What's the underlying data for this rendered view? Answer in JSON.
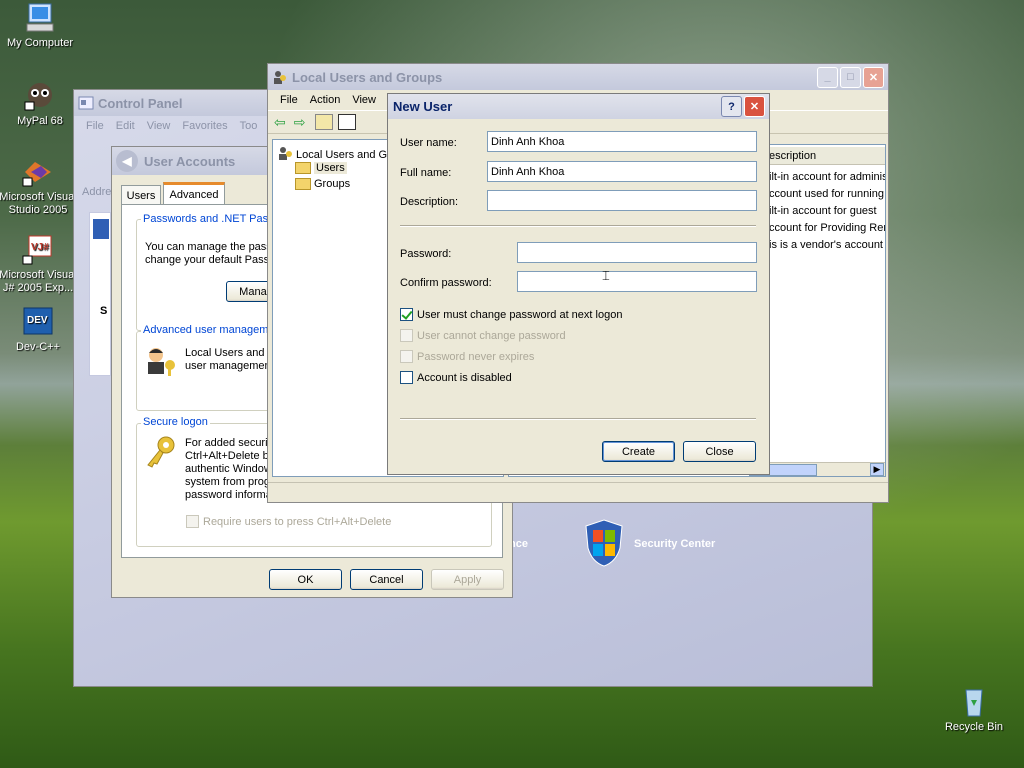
{
  "desktop": {
    "icons": [
      {
        "name": "my-computer",
        "label": "My Computer"
      },
      {
        "name": "mypal",
        "label": "MyPal 68"
      },
      {
        "name": "visual-studio",
        "label": "Microsoft Visual Studio 2005"
      },
      {
        "name": "visual-jsharp",
        "label": "Microsoft Visual J# 2005 Exp..."
      },
      {
        "name": "dev-cpp",
        "label": "Dev-C++"
      },
      {
        "name": "recycle-bin",
        "label": "Recycle Bin"
      }
    ]
  },
  "control_panel": {
    "title": "Control Panel",
    "menu": [
      "File",
      "Edit",
      "View",
      "Favorites",
      "Too"
    ],
    "address_label": "Addre",
    "security_center_label": "Security Center",
    "partial_label": "nce"
  },
  "user_accounts": {
    "title": "User Accounts",
    "tabs": [
      "Users",
      "Advanced"
    ],
    "active_tab": "Advanced",
    "passwords_group": "Passwords and .NET Passp",
    "passwords_text_1": "You can manage the pass",
    "passwords_text_2": "change your default Passp",
    "manage_button": "Manag",
    "advanced_group": "Advanced user manageme",
    "advanced_text_1": "Local Users and G",
    "advanced_text_2": "user managemen",
    "secure_group": "Secure logon",
    "secure_lines": [
      "For added securi",
      "Ctrl+Alt+Delete b",
      "authentic Window",
      "system from prog",
      "password informa"
    ],
    "require_ctrl_alt_del": "Require users to press Ctrl+Alt+Delete",
    "left_header": "S",
    "buttons": {
      "ok": "OK",
      "cancel": "Cancel",
      "apply": "Apply"
    }
  },
  "lusrmgr": {
    "title": "Local Users and Groups",
    "menu": [
      "File",
      "Action",
      "View"
    ],
    "tree_root": "Local Users and Gr",
    "tree_items": [
      "Users",
      "Groups"
    ],
    "column_header": "escription",
    "descriptions": [
      "ilt-in account for adminis",
      "ccount used for running",
      "ilt-in account for guest",
      "ccount for Providing Rem",
      "is is a vendor's account"
    ]
  },
  "new_user": {
    "title": "New User",
    "help": "?",
    "labels": {
      "username": "User name:",
      "fullname": "Full name:",
      "description": "Description:",
      "password": "Password:",
      "confirm": "Confirm password:"
    },
    "values": {
      "username": "Dinh Anh Khoa",
      "fullname": "Dinh Anh Khoa",
      "description": "",
      "password": "",
      "confirm": ""
    },
    "options": {
      "must_change": "User must change password at next logon",
      "cannot_change": "User cannot change password",
      "never_expires": "Password never expires",
      "disabled": "Account is disabled"
    },
    "buttons": {
      "create": "Create",
      "close": "Close"
    }
  },
  "colors": {
    "active_title": "#0a246a",
    "accent": "#0046d5"
  }
}
